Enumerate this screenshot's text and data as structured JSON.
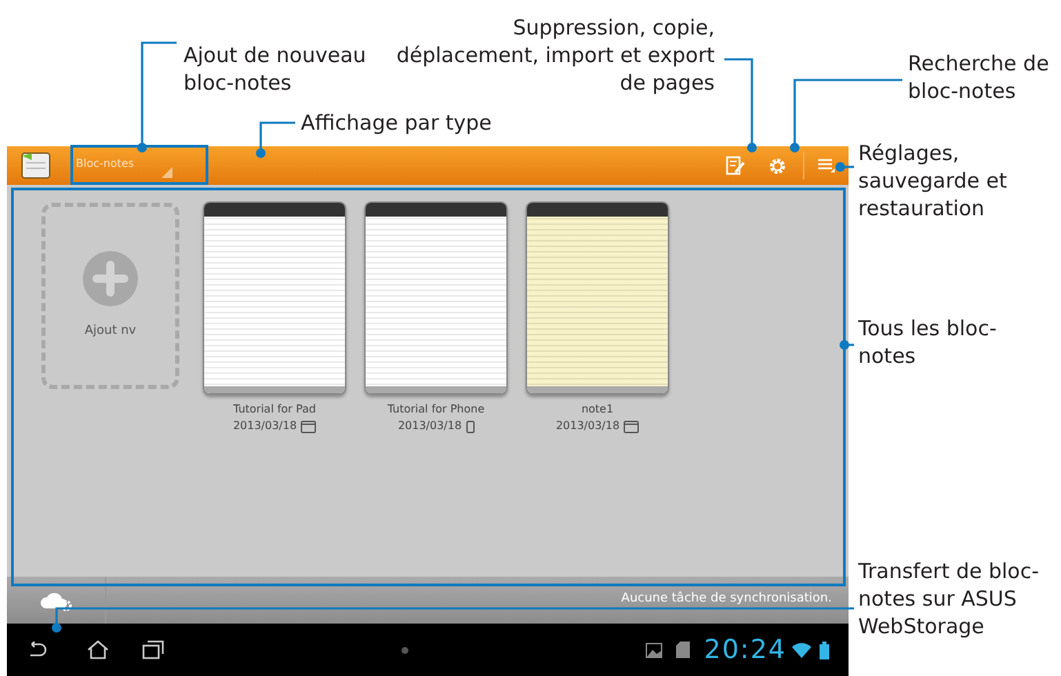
{
  "callouts": [
    {
      "text": "Ajout de nouveau bloc-notes"
    },
    {
      "text": "Affichage par type"
    },
    {
      "text": "Suppression, copie, déplacement, import et export de pages"
    },
    {
      "text": "Recherche de bloc-notes"
    },
    {
      "text": "Réglages, sauvegarde et restauration"
    },
    {
      "text": "Tous les bloc-notes"
    },
    {
      "text": "Transfert de bloc-notes sur ASUS WebStorage"
    }
  ],
  "action_bar": {
    "title": "Bloc-notes"
  },
  "add_card": {
    "label": "Ajout nv"
  },
  "notebooks": [
    {
      "name": "Tutorial for Pad",
      "date": "2013/03/18",
      "kind": "pad",
      "color": "#ffffff"
    },
    {
      "name": "Tutorial for Phone",
      "date": "2013/03/18",
      "kind": "phone",
      "color": "#ffffff"
    },
    {
      "name": "note1",
      "date": "2013/03/18",
      "kind": "pad",
      "color": "#f7f2c8"
    }
  ],
  "sync_bar": {
    "status": "Aucune tâche de synchronisation."
  },
  "nav_bar": {
    "time": "20:24"
  }
}
